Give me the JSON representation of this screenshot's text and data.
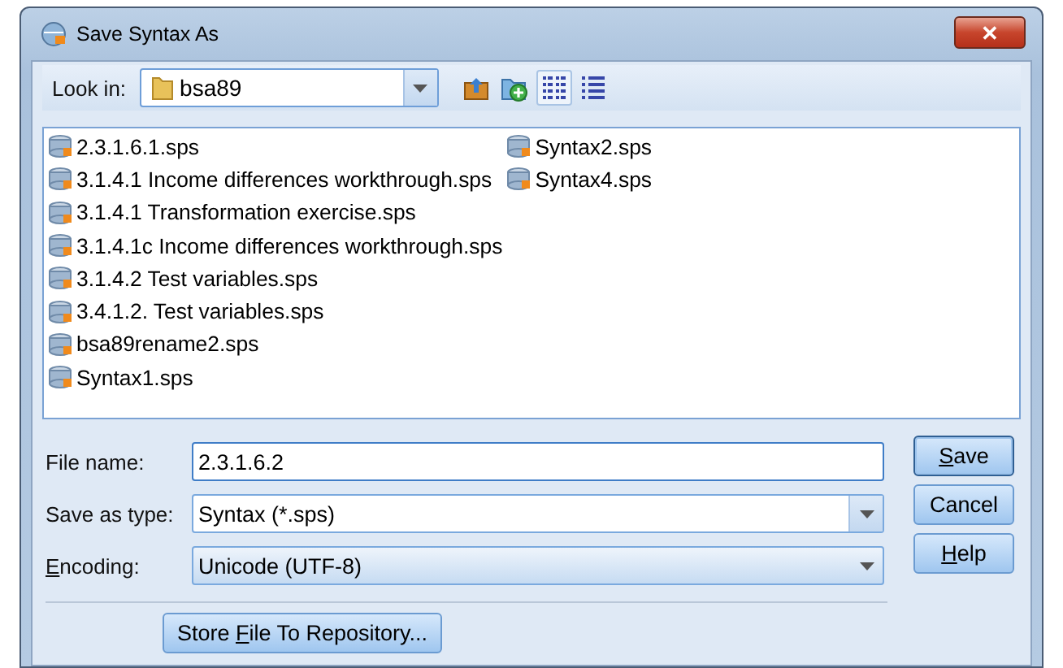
{
  "window": {
    "title": "Save Syntax As",
    "close_label": "✕"
  },
  "look_in": {
    "label": "Look in:",
    "value": "bsa89"
  },
  "tools": [
    {
      "kind": "up-folder",
      "selected": false
    },
    {
      "kind": "new-folder",
      "selected": false
    },
    {
      "kind": "list-view",
      "selected": true
    },
    {
      "kind": "details-view",
      "selected": false
    }
  ],
  "files": [
    {
      "name": "2.3.1.6.1.sps"
    },
    {
      "name": "3.1.4.1 Income differences workthrough.sps"
    },
    {
      "name": "3.1.4.1 Transformation exercise.sps"
    },
    {
      "name": "3.1.4.1c Income differences workthrough.sps"
    },
    {
      "name": "3.1.4.2 Test variables.sps"
    },
    {
      "name": "3.4.1.2. Test variables.sps"
    },
    {
      "name": "bsa89rename2.sps"
    },
    {
      "name": "Syntax1.sps"
    },
    {
      "name": "Syntax2.sps"
    },
    {
      "name": "Syntax4.sps"
    }
  ],
  "fields": [
    {
      "kind": "text",
      "label": {
        "pre": "File name:"
      },
      "value": "2.3.1.6.2"
    },
    {
      "kind": "combo",
      "label": {
        "pre": "Save as type:"
      },
      "value": "Syntax (*.sps)"
    },
    {
      "kind": "dropdown",
      "label": {
        "key": "E",
        "post": "ncoding:"
      },
      "value": "Unicode (UTF-8)"
    }
  ],
  "buttons": [
    {
      "label": {
        "key": "S",
        "post": "ave"
      },
      "default": true
    },
    {
      "label": {
        "pre": "Cancel"
      },
      "default": false
    },
    {
      "label": {
        "key": "H",
        "post": "elp"
      },
      "default": false
    }
  ],
  "repository_button": {
    "label": {
      "pre": "Store ",
      "key": "F",
      "post": "ile To Repository..."
    }
  }
}
